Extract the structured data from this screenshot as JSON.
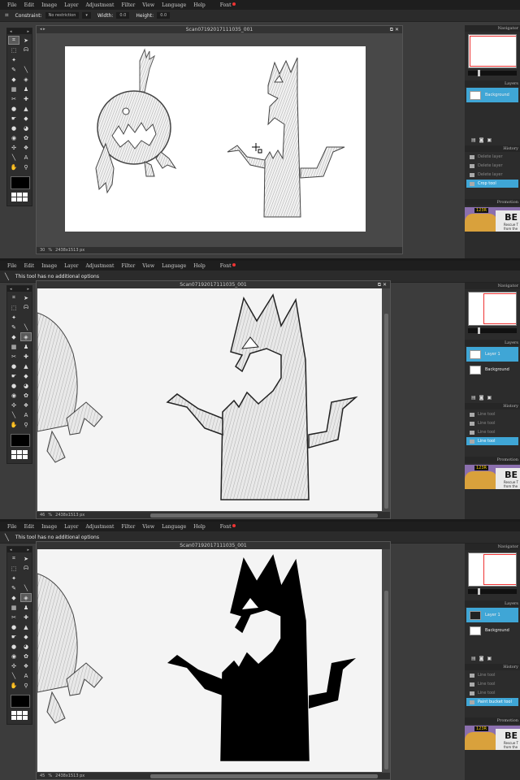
{
  "menu": [
    "File",
    "Edit",
    "Image",
    "Layer",
    "Adjustment",
    "Filter",
    "View",
    "Language",
    "Help",
    "Font"
  ],
  "panel1": {
    "options": {
      "constraint_label": "Constraint:",
      "constraint_value": "No restriction",
      "width_label": "Width:",
      "width_value": "0.0",
      "height_label": "Height:",
      "height_value": "0.0"
    },
    "doc_title": "Scan07192017111035_001",
    "zoom": "30",
    "size": "2438x1513 px",
    "layers": [
      {
        "name": "Background",
        "selected": true
      }
    ],
    "history": [
      "Delete layer",
      "Delete layer",
      "Delete layer",
      "Crop tool"
    ]
  },
  "panel2": {
    "options": {
      "message": "This tool has no additional options"
    },
    "doc_title": "Scan07192017111035_001",
    "zoom": "46",
    "size": "2438x1513 px",
    "layers": [
      {
        "name": "Layer 1",
        "selected": true
      },
      {
        "name": "Background",
        "selected": false
      }
    ],
    "history": [
      "Line tool",
      "Line tool",
      "Line tool",
      "Line tool"
    ]
  },
  "panel3": {
    "options": {
      "message": "This tool has no additional options"
    },
    "doc_title": "Scan07192017111035_001",
    "zoom": "45",
    "size": "2438x1513 px",
    "layers": [
      {
        "name": "Layer 1",
        "selected": true
      },
      {
        "name": "Background",
        "selected": false
      }
    ],
    "history": [
      "Line tool",
      "Line tool",
      "Line tool",
      "Paint bucket tool"
    ]
  },
  "right_panel": {
    "navigator": "Navigator",
    "layers": "Layers",
    "history": "History",
    "promotion": "Promotion"
  },
  "promo": {
    "badge": "123R",
    "headline": "BE",
    "sub_line1": "Rescue T",
    "sub_line2": "from the"
  },
  "colors": {
    "accent": "#3fa6d6",
    "fill": "#000000",
    "canvas": "#ffffff",
    "ui": "#3c3c3c"
  }
}
